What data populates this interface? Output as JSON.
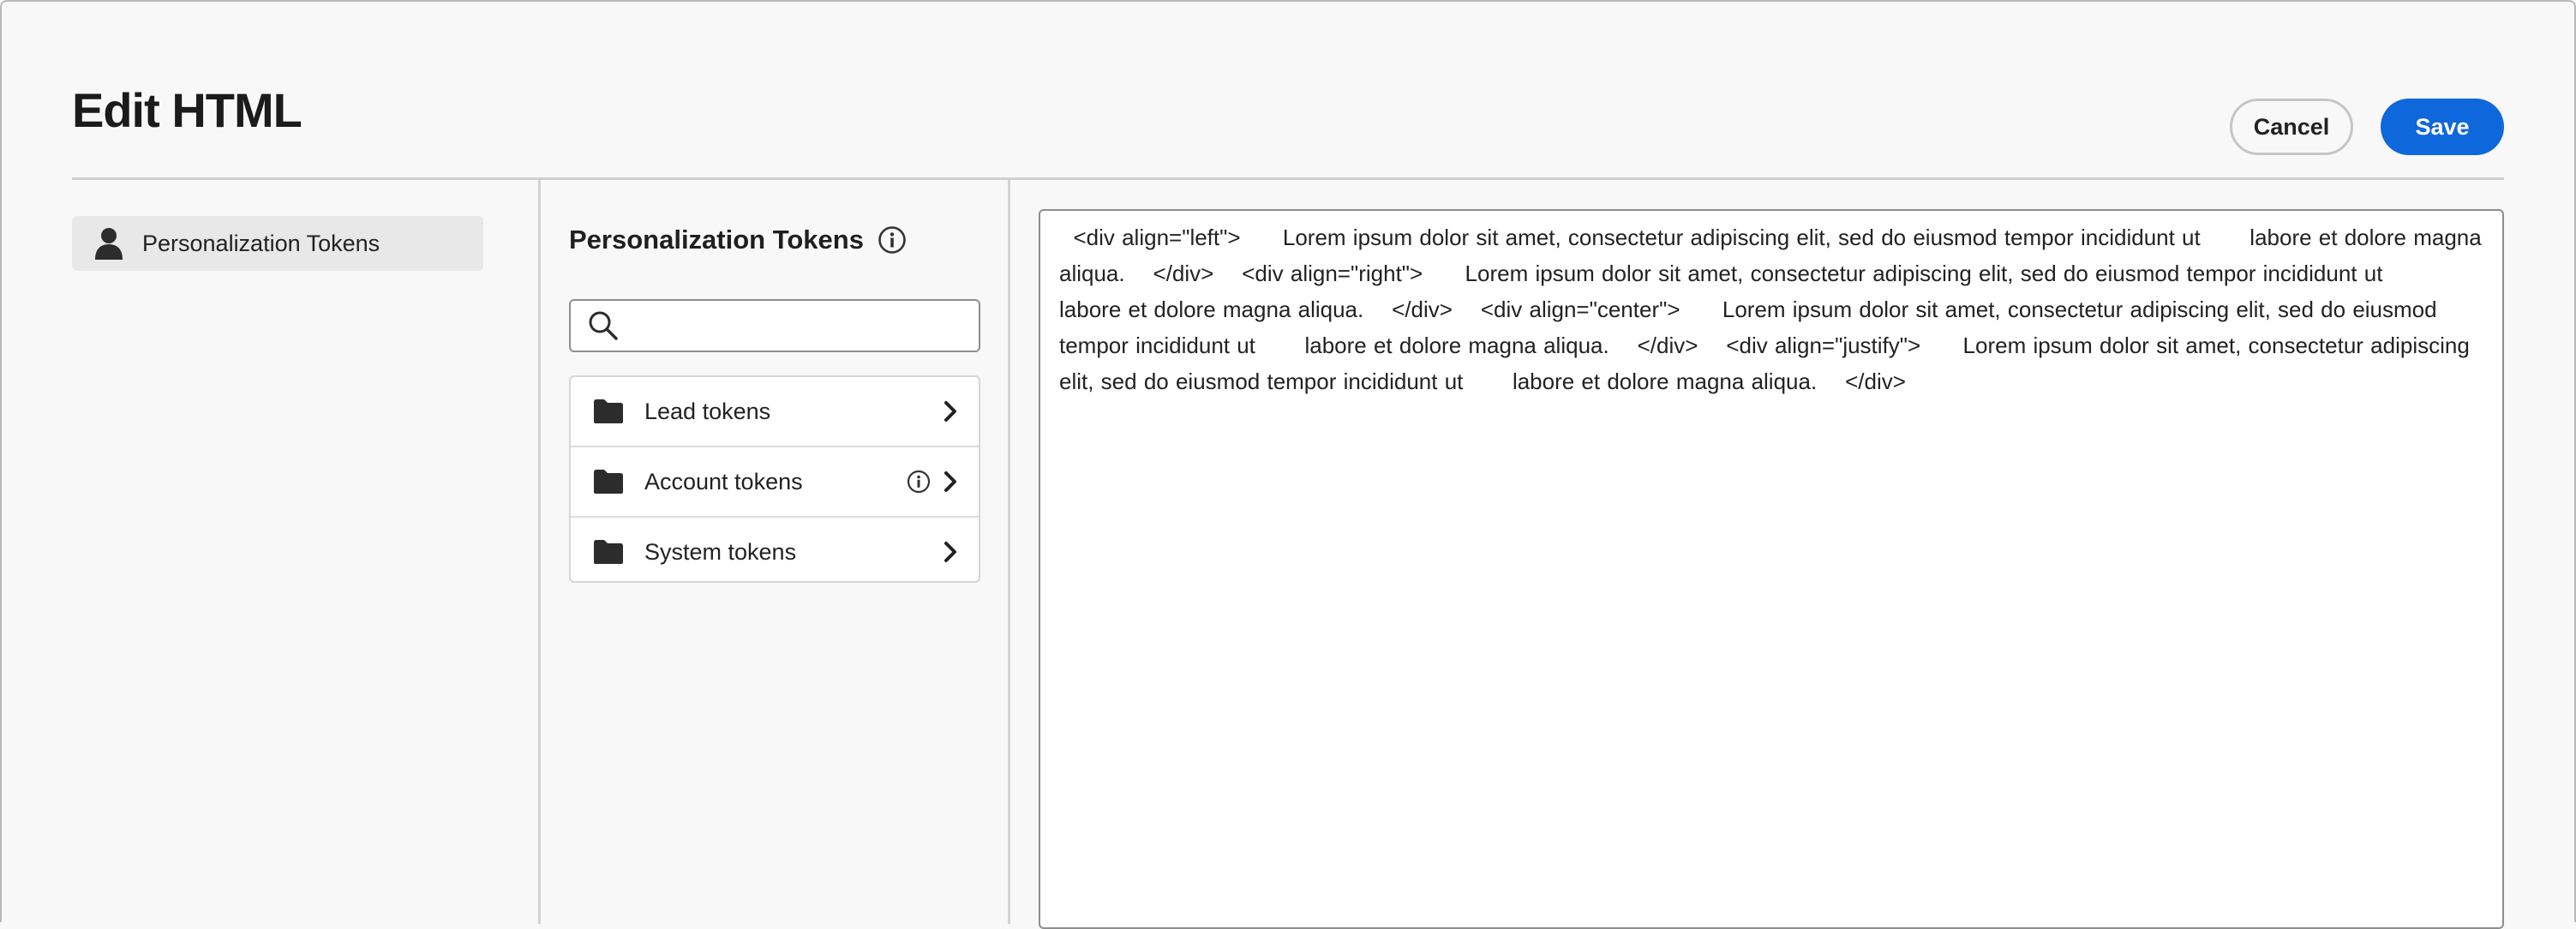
{
  "dialog": {
    "title": "Edit HTML",
    "cancel_label": "Cancel",
    "save_label": "Save",
    "accent_color": "#0f67dc"
  },
  "sidebar": {
    "items": [
      {
        "label": "Personalization Tokens",
        "icon": "user-icon",
        "selected": true
      }
    ]
  },
  "tokens_panel": {
    "title": "Personalization Tokens",
    "title_icon": "info-icon",
    "search": {
      "value": "",
      "placeholder": "",
      "icon": "search-icon"
    },
    "items": [
      {
        "label": "Lead tokens",
        "icon": "folder-icon",
        "has_info": false
      },
      {
        "label": "Account tokens",
        "icon": "folder-icon",
        "has_info": true
      },
      {
        "label": "System tokens",
        "icon": "folder-icon",
        "has_info": false
      }
    ]
  },
  "editor": {
    "content": "  <div align=\"left\">      Lorem ipsum dolor sit amet, consectetur adipiscing elit, sed do eiusmod tempor incididunt ut       labore et dolore magna aliqua.    </div>    <div align=\"right\">      Lorem ipsum dolor sit amet, consectetur adipiscing elit, sed do eiusmod tempor incididunt ut       labore et dolore magna aliqua.    </div>    <div align=\"center\">      Lorem ipsum dolor sit amet, consectetur adipiscing elit, sed do eiusmod tempor incididunt ut       labore et dolore magna aliqua.    </div>    <div align=\"justify\">      Lorem ipsum dolor sit amet, consectetur adipiscing elit, sed do eiusmod tempor incididunt ut       labore et dolore magna aliqua.    </div>"
  }
}
